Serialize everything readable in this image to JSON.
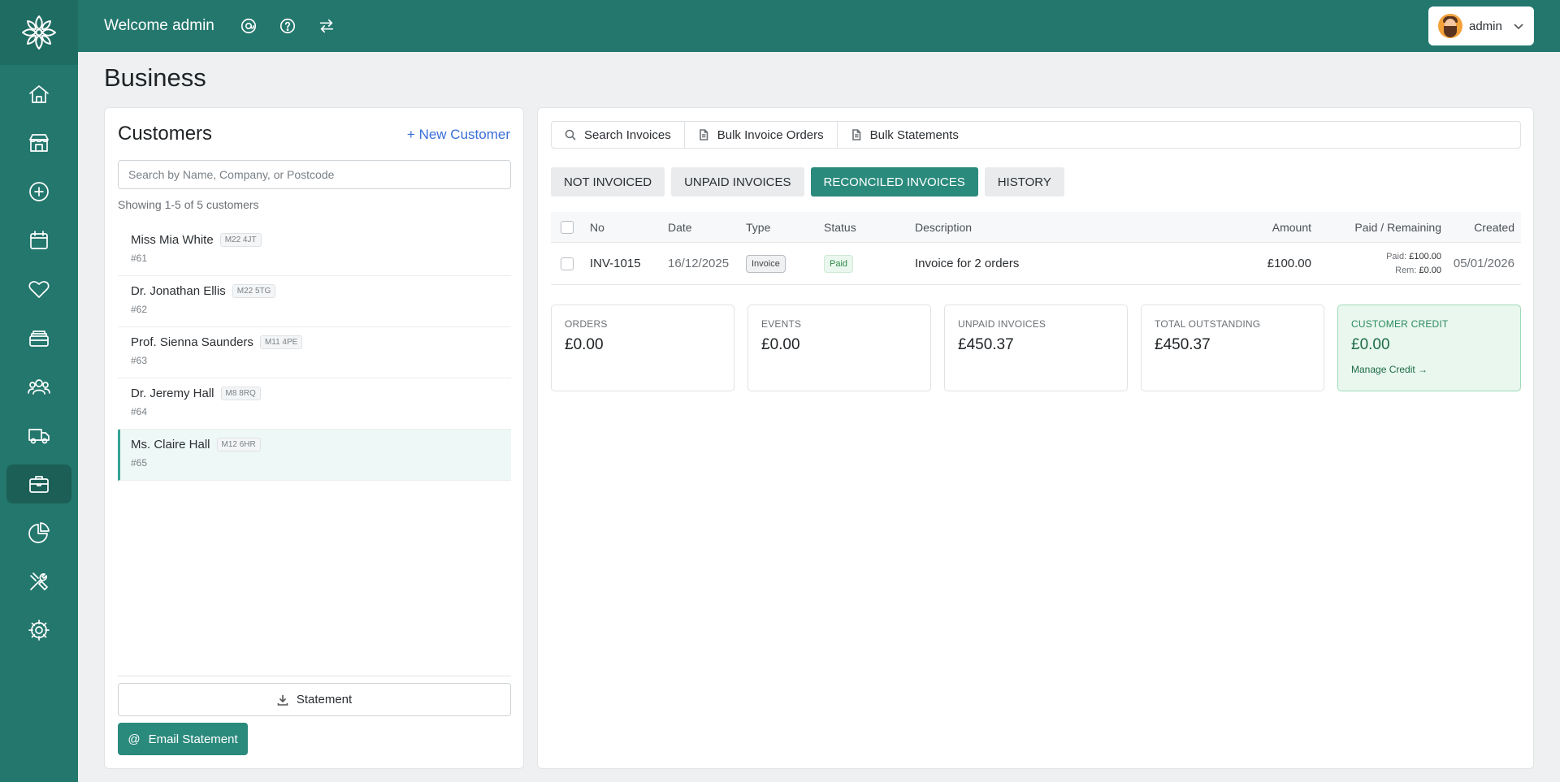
{
  "header": {
    "welcome": "Welcome admin",
    "user_name": "admin"
  },
  "page": {
    "title": "Business"
  },
  "customers": {
    "title": "Customers",
    "new_label": "+ New Customer",
    "search_placeholder": "Search by Name, Company, or Postcode",
    "showing": "Showing 1-5 of 5 customers",
    "items": [
      {
        "name": "Miss Mia White",
        "postcode": "M22 4JT",
        "id": "#61"
      },
      {
        "name": "Dr. Jonathan Ellis",
        "postcode": "M22 5TG",
        "id": "#62"
      },
      {
        "name": "Prof. Sienna Saunders",
        "postcode": "M11 4PE",
        "id": "#63"
      },
      {
        "name": "Dr. Jeremy Hall",
        "postcode": "M8 8RQ",
        "id": "#64"
      },
      {
        "name": "Ms. Claire Hall",
        "postcode": "M12 6HR",
        "id": "#65"
      }
    ],
    "statement_label": "Statement",
    "email_statement_label": "Email Statement"
  },
  "toolbar": {
    "search_invoices": "Search Invoices",
    "bulk_invoice_orders": "Bulk Invoice Orders",
    "bulk_statements": "Bulk Statements"
  },
  "tabs": [
    "NOT INVOICED",
    "UNPAID INVOICES",
    "RECONCILED INVOICES",
    "HISTORY"
  ],
  "table": {
    "headers": {
      "no": "No",
      "date": "Date",
      "type": "Type",
      "status": "Status",
      "description": "Description",
      "amount": "Amount",
      "paid_remaining": "Paid / Remaining",
      "created": "Created"
    },
    "rows": [
      {
        "no": "INV-1015",
        "date": "16/12/2025",
        "type": "Invoice",
        "status": "Paid",
        "description": "Invoice for 2 orders",
        "amount": "£100.00",
        "paid_label": "Paid:",
        "paid_value": "£100.00",
        "rem_label": "Rem:",
        "rem_value": "£0.00",
        "created": "05/01/2026"
      }
    ]
  },
  "stats": {
    "orders": {
      "label": "ORDERS",
      "value": "£0.00"
    },
    "events": {
      "label": "EVENTS",
      "value": "£0.00"
    },
    "unpaid": {
      "label": "UNPAID INVOICES",
      "value": "£450.37"
    },
    "outstanding": {
      "label": "TOTAL OUTSTANDING",
      "value": "£450.37"
    },
    "credit": {
      "label": "CUSTOMER CREDIT",
      "value": "£0.00",
      "link": "Manage Credit →"
    }
  },
  "colors": {
    "brand": "#23776d",
    "accent": "#2a8a7c",
    "link": "#3b6fd8",
    "credit_bg": "#e9f7ef"
  }
}
